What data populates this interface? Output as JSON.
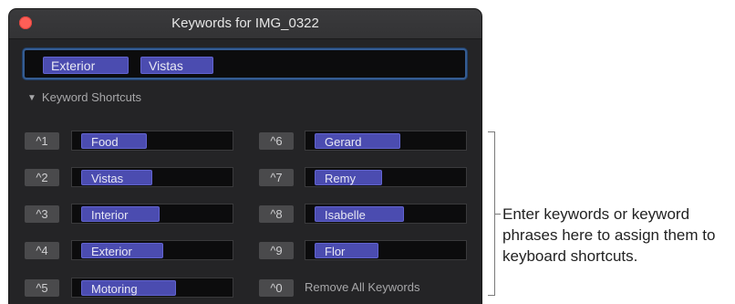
{
  "window": {
    "title": "Keywords for IMG_0322"
  },
  "keyword_field": {
    "tokens": [
      "Exterior",
      "Vistas"
    ]
  },
  "shortcuts_section": {
    "disclosure_glyph": "▼",
    "label": "Keyword Shortcuts"
  },
  "shortcuts": {
    "left": [
      {
        "key": "^1",
        "keyword": "Food"
      },
      {
        "key": "^2",
        "keyword": "Vistas"
      },
      {
        "key": "^3",
        "keyword": "Interior"
      },
      {
        "key": "^4",
        "keyword": "Exterior"
      },
      {
        "key": "^5",
        "keyword": "Motoring"
      }
    ],
    "right": [
      {
        "key": "^6",
        "keyword": "Gerard"
      },
      {
        "key": "^7",
        "keyword": "Remy"
      },
      {
        "key": "^8",
        "keyword": "Isabelle"
      },
      {
        "key": "^9",
        "keyword": "Flor"
      },
      {
        "key": "^0",
        "label": "Remove All Keywords"
      }
    ]
  },
  "callout": {
    "text": "Enter keywords or keyword phrases here to assign them to keyboard shortcuts."
  },
  "colors": {
    "window_bg": "#242426",
    "token_bg": "#4b4cb0",
    "focus_ring": "#355c92",
    "close_button": "#fe5f57"
  },
  "icons": {
    "close": "close-icon",
    "disclosure": "disclosure-triangle-icon"
  }
}
